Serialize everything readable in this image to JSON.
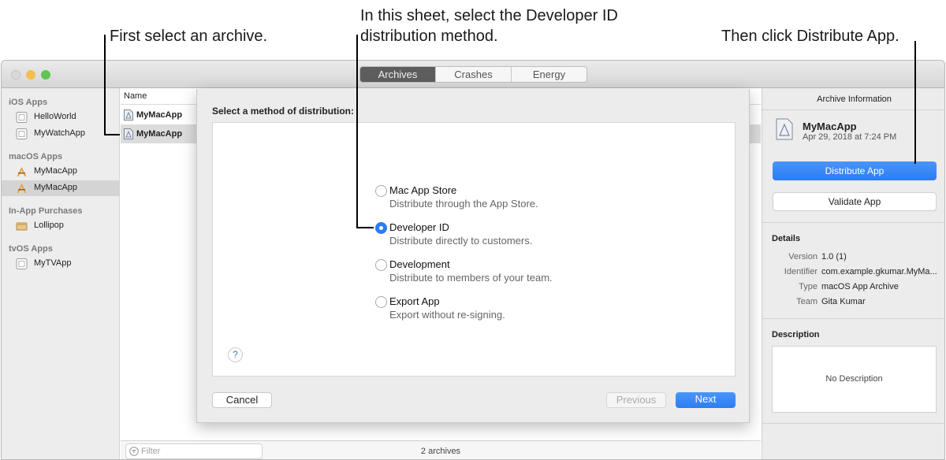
{
  "callouts": {
    "first": "First select an archive.",
    "sheet_line1": "In this sheet, select the Developer ID",
    "sheet_line2": "distribution method.",
    "then": "Then click Distribute App."
  },
  "colors": {
    "accent": "#2c7df3",
    "close": "#ee5f58",
    "minimize": "#f5bf4f",
    "zoom": "#61c454"
  },
  "toolbar": {
    "tabs": [
      "Archives",
      "Crashes",
      "Energy"
    ],
    "selected_tab": "Archives"
  },
  "sidebar": {
    "groups": [
      {
        "title": "iOS Apps",
        "items": [
          {
            "label": "HelloWorld",
            "icon": "ios-app-icon"
          },
          {
            "label": "MyWatchApp",
            "icon": "ios-app-icon"
          }
        ]
      },
      {
        "title": "macOS Apps",
        "items": [
          {
            "label": "MyMacApp",
            "icon": "macos-app-icon"
          },
          {
            "label": "MyMacApp",
            "icon": "macos-app-icon",
            "selected": true
          }
        ]
      },
      {
        "title": "In-App Purchases",
        "items": [
          {
            "label": "Lollipop",
            "icon": "package-icon"
          }
        ]
      },
      {
        "title": "tvOS Apps",
        "items": [
          {
            "label": "MyTVApp",
            "icon": "tv-app-icon"
          }
        ]
      }
    ]
  },
  "list": {
    "column": "Name",
    "rows": [
      {
        "name": "MyMacApp"
      },
      {
        "name": "MyMacApp",
        "selected": true
      }
    ],
    "filter_placeholder": "Filter",
    "count": "2 archives"
  },
  "sheet": {
    "title": "Select a method of distribution:",
    "options": [
      {
        "title": "Mac App Store",
        "desc": "Distribute through the App Store.",
        "selected": false
      },
      {
        "title": "Developer ID",
        "desc": "Distribute directly to customers.",
        "selected": true
      },
      {
        "title": "Development",
        "desc": "Distribute to members of your team.",
        "selected": false
      },
      {
        "title": "Export App",
        "desc": "Export without re-signing.",
        "selected": false
      }
    ],
    "help": "?",
    "cancel": "Cancel",
    "previous": "Previous",
    "next": "Next"
  },
  "inspector": {
    "title": "Archive Information",
    "app_name": "MyMacApp",
    "date": "Apr 29, 2018 at 7:24 PM",
    "distribute": "Distribute App",
    "validate": "Validate App",
    "details_title": "Details",
    "details": [
      {
        "key": "Version",
        "value": "1.0 (1)"
      },
      {
        "key": "Identifier",
        "value": "com.example.gkumar.MyMa..."
      },
      {
        "key": "Type",
        "value": "macOS App Archive"
      },
      {
        "key": "Team",
        "value": "Gita Kumar"
      }
    ],
    "description_title": "Description",
    "description": "No Description"
  }
}
